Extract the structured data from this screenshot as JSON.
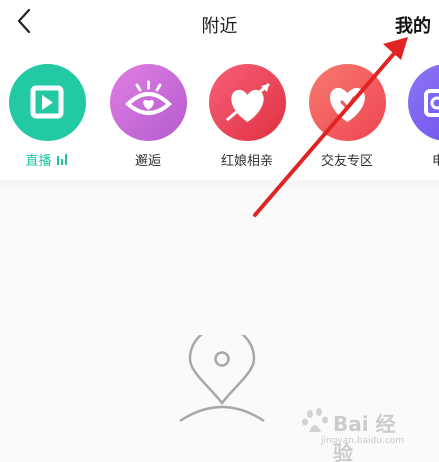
{
  "header": {
    "title": "附近",
    "right_action": "我的",
    "back_icon": "chevron-left-icon"
  },
  "categories": [
    {
      "label": "直播",
      "icon": "play-icon",
      "color": "#22c9a3",
      "active": true,
      "badge_icon": "live-bars-icon"
    },
    {
      "label": "邂逅",
      "icon": "eye-heart-icon",
      "color": "#c86ad8",
      "active": false
    },
    {
      "label": "红娘相亲",
      "icon": "heart-arrow-icon",
      "color": "#f0445a",
      "active": false
    },
    {
      "label": "交友专区",
      "icon": "heart-icon",
      "color": "#f45e61",
      "active": false
    },
    {
      "label": "电",
      "icon": "camera-icon",
      "color": "#7a64f4",
      "active": false
    }
  ],
  "empty_state": {
    "icon": "location-pin-icon"
  },
  "annotation": {
    "type": "arrow",
    "color": "#e02424"
  },
  "watermark": {
    "text": "Bai 经验",
    "sub": "jingyan.baidu.com"
  }
}
